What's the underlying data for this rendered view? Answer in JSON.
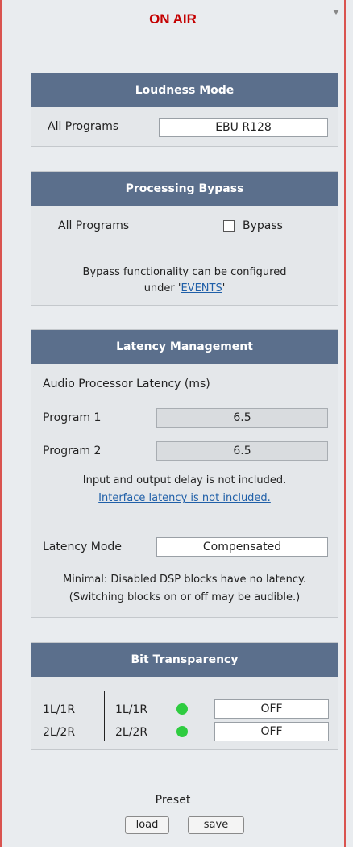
{
  "header": {
    "title": "ON AIR"
  },
  "loudness": {
    "title": "Loudness Mode",
    "label": "All Programs",
    "value": "EBU R128"
  },
  "bypass": {
    "title": "Processing Bypass",
    "label": "All Programs",
    "checkbox_label": "Bypass",
    "checked": false,
    "note_line1": "Bypass functionality can be configured",
    "note_prefix": "under '",
    "note_link": "EVENTS",
    "note_suffix": "'"
  },
  "latency": {
    "title": "Latency Management",
    "subtitle": "Audio Processor Latency (ms)",
    "program1_label": "Program 1",
    "program1_value": "6.5",
    "program2_label": "Program 2",
    "program2_value": "6.5",
    "note1": "Input and output delay is not included.",
    "note_link": "Interface latency is not included.",
    "mode_label": "Latency Mode",
    "mode_value": "Compensated",
    "mode_note1": "Minimal: Disabled DSP blocks have no latency.",
    "mode_note2": "(Switching blocks on or off may be audible.)"
  },
  "bit": {
    "title": "Bit Transparency",
    "rows": [
      {
        "left": "1L/1R",
        "mid": "1L/1R",
        "status_color": "#2ecc40",
        "value": "OFF"
      },
      {
        "left": "2L/2R",
        "mid": "2L/2R",
        "status_color": "#2ecc40",
        "value": "OFF"
      }
    ]
  },
  "preset": {
    "label": "Preset",
    "load": "load",
    "save": "save"
  },
  "icons": {
    "scroll": "chevron-down-icon",
    "status": "status-dot-icon"
  }
}
